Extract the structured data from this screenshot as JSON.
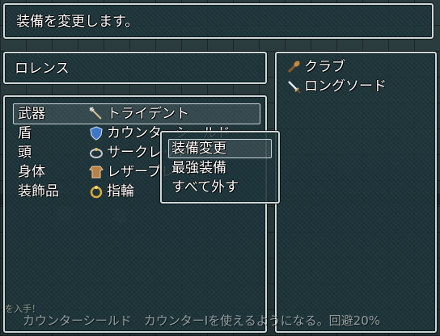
{
  "help": {
    "text": "装備を変更します。"
  },
  "actor": {
    "name": "ロレンス"
  },
  "slots": [
    {
      "label": "武器",
      "item": "トライデント",
      "icon": "trident-icon",
      "selected": true
    },
    {
      "label": "盾",
      "item": "カウンターシールド",
      "icon": "shield-icon"
    },
    {
      "label": "頭",
      "item": "サークレット",
      "icon": "circlet-icon"
    },
    {
      "label": "身体",
      "item": "レザープレート",
      "icon": "armor-icon"
    },
    {
      "label": "装飾品",
      "item": "指輪",
      "icon": "ring-icon"
    }
  ],
  "command_menu": [
    {
      "label": "装備変更",
      "selected": true
    },
    {
      "label": "最強装備"
    },
    {
      "label": "すべて外す"
    }
  ],
  "item_list": [
    {
      "name": "クラブ",
      "icon": "club-icon"
    },
    {
      "name": "ロングソード",
      "icon": "sword-icon"
    }
  ],
  "bottom": {
    "note": "を入手！",
    "message": "カウンターシールド　カウンターIを使えるようになる。回避20%"
  },
  "colors": {
    "window_border": "#cfd8d8",
    "window_fill": "#1c343a",
    "text": "#ffffff"
  }
}
